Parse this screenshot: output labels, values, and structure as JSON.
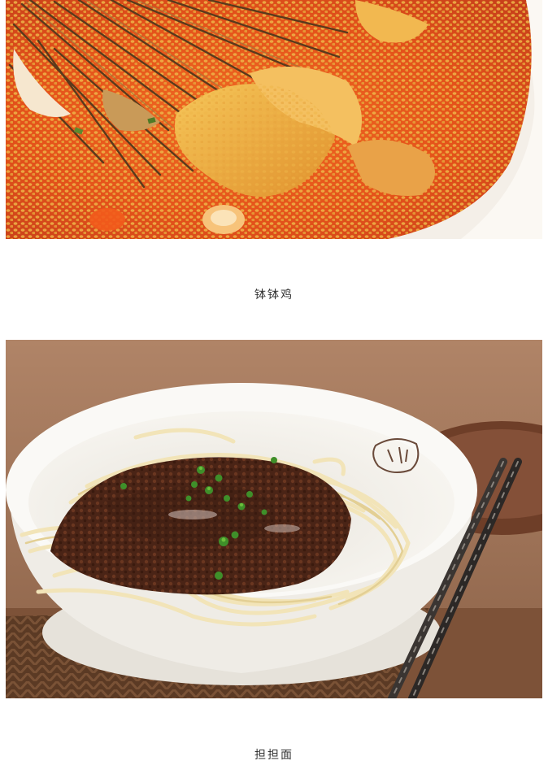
{
  "article": {
    "items": [
      {
        "caption": "钵钵鸡",
        "photo": "bobo-chicken-photo"
      },
      {
        "caption": "担担面",
        "photo": "dandan-noodles-photo"
      }
    ]
  },
  "colors": {
    "chili_oil": "#e8541c",
    "sesame": "#e8a93a",
    "bowl": "#f3f1ec",
    "noodle": "#efe0b0",
    "sauce": "#4a2416",
    "scallion": "#3f8f2a",
    "table": "#8a5a3e",
    "caption_text": "#333333"
  }
}
